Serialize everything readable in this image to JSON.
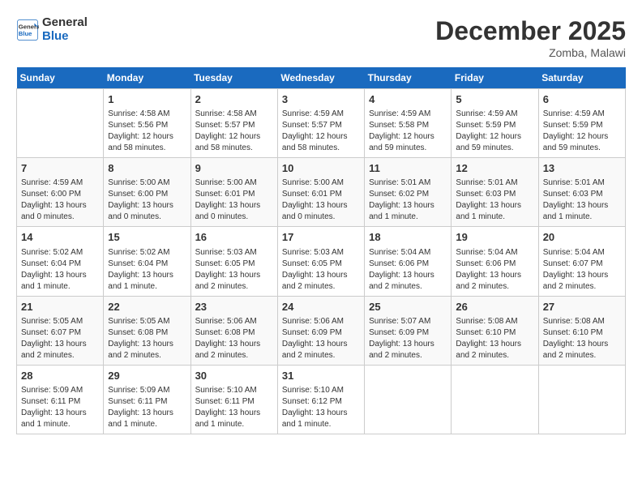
{
  "logo": {
    "line1": "General",
    "line2": "Blue"
  },
  "title": "December 2025",
  "location": "Zomba, Malawi",
  "headers": [
    "Sunday",
    "Monday",
    "Tuesday",
    "Wednesday",
    "Thursday",
    "Friday",
    "Saturday"
  ],
  "weeks": [
    [
      {
        "day": "",
        "info": ""
      },
      {
        "day": "1",
        "info": "Sunrise: 4:58 AM\nSunset: 5:56 PM\nDaylight: 12 hours\nand 58 minutes."
      },
      {
        "day": "2",
        "info": "Sunrise: 4:58 AM\nSunset: 5:57 PM\nDaylight: 12 hours\nand 58 minutes."
      },
      {
        "day": "3",
        "info": "Sunrise: 4:59 AM\nSunset: 5:57 PM\nDaylight: 12 hours\nand 58 minutes."
      },
      {
        "day": "4",
        "info": "Sunrise: 4:59 AM\nSunset: 5:58 PM\nDaylight: 12 hours\nand 59 minutes."
      },
      {
        "day": "5",
        "info": "Sunrise: 4:59 AM\nSunset: 5:59 PM\nDaylight: 12 hours\nand 59 minutes."
      },
      {
        "day": "6",
        "info": "Sunrise: 4:59 AM\nSunset: 5:59 PM\nDaylight: 12 hours\nand 59 minutes."
      }
    ],
    [
      {
        "day": "7",
        "info": "Sunrise: 4:59 AM\nSunset: 6:00 PM\nDaylight: 13 hours\nand 0 minutes."
      },
      {
        "day": "8",
        "info": "Sunrise: 5:00 AM\nSunset: 6:00 PM\nDaylight: 13 hours\nand 0 minutes."
      },
      {
        "day": "9",
        "info": "Sunrise: 5:00 AM\nSunset: 6:01 PM\nDaylight: 13 hours\nand 0 minutes."
      },
      {
        "day": "10",
        "info": "Sunrise: 5:00 AM\nSunset: 6:01 PM\nDaylight: 13 hours\nand 0 minutes."
      },
      {
        "day": "11",
        "info": "Sunrise: 5:01 AM\nSunset: 6:02 PM\nDaylight: 13 hours\nand 1 minute."
      },
      {
        "day": "12",
        "info": "Sunrise: 5:01 AM\nSunset: 6:03 PM\nDaylight: 13 hours\nand 1 minute."
      },
      {
        "day": "13",
        "info": "Sunrise: 5:01 AM\nSunset: 6:03 PM\nDaylight: 13 hours\nand 1 minute."
      }
    ],
    [
      {
        "day": "14",
        "info": "Sunrise: 5:02 AM\nSunset: 6:04 PM\nDaylight: 13 hours\nand 1 minute."
      },
      {
        "day": "15",
        "info": "Sunrise: 5:02 AM\nSunset: 6:04 PM\nDaylight: 13 hours\nand 1 minute."
      },
      {
        "day": "16",
        "info": "Sunrise: 5:03 AM\nSunset: 6:05 PM\nDaylight: 13 hours\nand 2 minutes."
      },
      {
        "day": "17",
        "info": "Sunrise: 5:03 AM\nSunset: 6:05 PM\nDaylight: 13 hours\nand 2 minutes."
      },
      {
        "day": "18",
        "info": "Sunrise: 5:04 AM\nSunset: 6:06 PM\nDaylight: 13 hours\nand 2 minutes."
      },
      {
        "day": "19",
        "info": "Sunrise: 5:04 AM\nSunset: 6:06 PM\nDaylight: 13 hours\nand 2 minutes."
      },
      {
        "day": "20",
        "info": "Sunrise: 5:04 AM\nSunset: 6:07 PM\nDaylight: 13 hours\nand 2 minutes."
      }
    ],
    [
      {
        "day": "21",
        "info": "Sunrise: 5:05 AM\nSunset: 6:07 PM\nDaylight: 13 hours\nand 2 minutes."
      },
      {
        "day": "22",
        "info": "Sunrise: 5:05 AM\nSunset: 6:08 PM\nDaylight: 13 hours\nand 2 minutes."
      },
      {
        "day": "23",
        "info": "Sunrise: 5:06 AM\nSunset: 6:08 PM\nDaylight: 13 hours\nand 2 minutes."
      },
      {
        "day": "24",
        "info": "Sunrise: 5:06 AM\nSunset: 6:09 PM\nDaylight: 13 hours\nand 2 minutes."
      },
      {
        "day": "25",
        "info": "Sunrise: 5:07 AM\nSunset: 6:09 PM\nDaylight: 13 hours\nand 2 minutes."
      },
      {
        "day": "26",
        "info": "Sunrise: 5:08 AM\nSunset: 6:10 PM\nDaylight: 13 hours\nand 2 minutes."
      },
      {
        "day": "27",
        "info": "Sunrise: 5:08 AM\nSunset: 6:10 PM\nDaylight: 13 hours\nand 2 minutes."
      }
    ],
    [
      {
        "day": "28",
        "info": "Sunrise: 5:09 AM\nSunset: 6:11 PM\nDaylight: 13 hours\nand 1 minute."
      },
      {
        "day": "29",
        "info": "Sunrise: 5:09 AM\nSunset: 6:11 PM\nDaylight: 13 hours\nand 1 minute."
      },
      {
        "day": "30",
        "info": "Sunrise: 5:10 AM\nSunset: 6:11 PM\nDaylight: 13 hours\nand 1 minute."
      },
      {
        "day": "31",
        "info": "Sunrise: 5:10 AM\nSunset: 6:12 PM\nDaylight: 13 hours\nand 1 minute."
      },
      {
        "day": "",
        "info": ""
      },
      {
        "day": "",
        "info": ""
      },
      {
        "day": "",
        "info": ""
      }
    ]
  ]
}
